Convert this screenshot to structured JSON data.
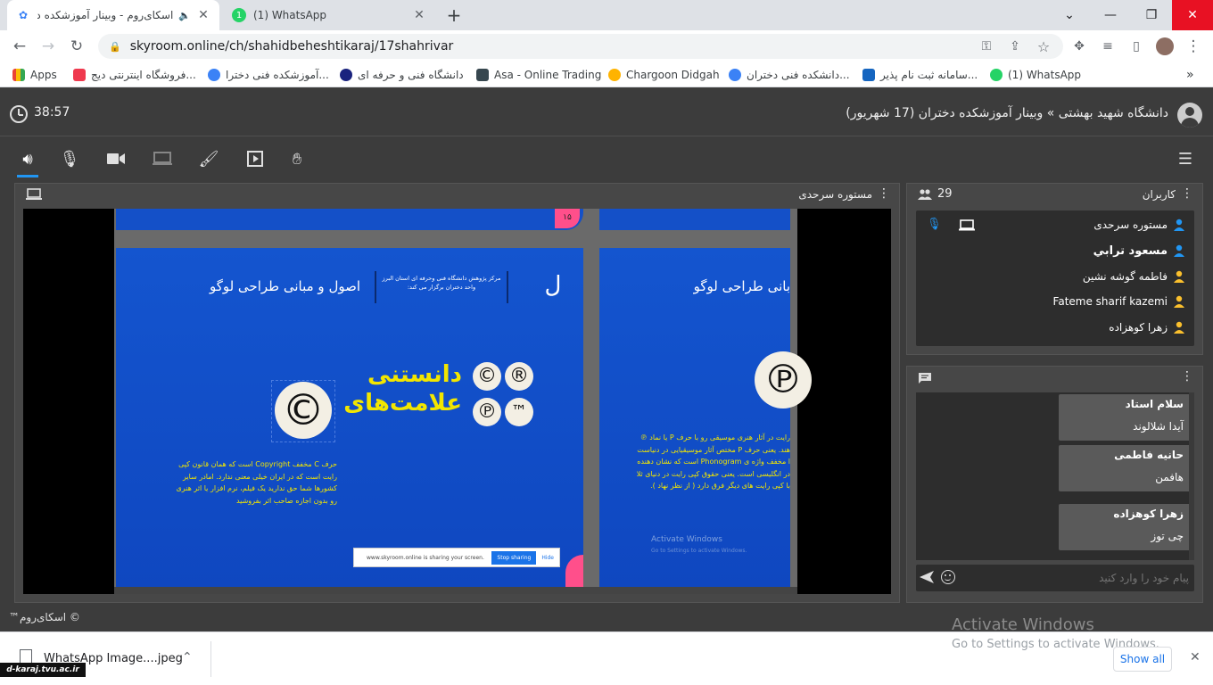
{
  "browser": {
    "tabs": [
      {
        "title": "اسکای‌روم - وبینار آموزشکده دخ",
        "active": true
      },
      {
        "title": "(1) WhatsApp",
        "active": false
      }
    ],
    "new_tab": "+",
    "url": "skyroom.online/ch/shahidbeheshtikaraj/17shahrivar",
    "bookmarks": [
      "Apps",
      "فروشگاه اینترنتی دیج...",
      "آموزشکده فنی دخترا...",
      "دانشگاه فنی و حرفه ای",
      "Asa - Online Trading",
      "Chargoon Didgah",
      "دانشکده فنی دختران...",
      "سامانه ثبت نام پذیر...",
      "(1) WhatsApp"
    ],
    "more_bookmarks": "»"
  },
  "header": {
    "timer": "38:57",
    "title": "دانشگاه شهید بهشتی » وبینار آموزشکده دختران (17 شهریور)"
  },
  "screen_panel": {
    "presenter": "مستوره سرحدی"
  },
  "slide": {
    "page_number": "۱۵",
    "header_org": "مرکز پژوهش دانشگاه فنی وحرفه ای استان البرز واحد دختران برگزار می کند:",
    "title": "اصول و مبانی طراحی لوگو",
    "title_right": "بانی طراحی لوگو",
    "heading_line1": "دانستنی",
    "heading_line2": "علامت‌های",
    "symbols": [
      "©",
      "®",
      "℗",
      "™"
    ],
    "body": "حرف C مخفف Copyright است که همان قانون کپی رایت است که در ایران خیلی معنی ندارد. امادر سایر کشورها شما حق ندارید یک فیلم، نرم افزار یا اثر هنری رو بدون اجازه صاحب اثر بفروشید",
    "body_right": "رایت در آثار هنری موسیقی رو با حرف P یا نماد ℗ هند. یعنی حرف P مختص آثار موسیقیایی در دنیاست ا مخفف واژه ی Phonogram است که نشان دهنده در انگلیسی است. یعنی حقوق کپی رایت در دنیای ثلا با کپی رایت های دیگر فرق دارد ( از نظر نهاد ).",
    "sharing_bar_text": "www.skyroom.online is sharing your screen.",
    "stop_sharing": "Stop sharing",
    "hide": "Hide",
    "watermark": "Activate Windows",
    "watermark_sub": "Go to Settings to activate Windows."
  },
  "users_panel": {
    "title": "کاربران",
    "count": "29",
    "users": [
      {
        "name": "مستوره سرحدی",
        "color": "#2196f3",
        "bold": false
      },
      {
        "name": "مسعود ترابي",
        "color": "#2196f3",
        "bold": true
      },
      {
        "name": "فاطمه گوشه نشین",
        "color": "#fbc02d",
        "bold": false
      },
      {
        "name": "Fateme sharif kazemi",
        "color": "#fbc02d",
        "bold": false
      },
      {
        "name": "زهرا کوهزاده",
        "color": "#fbc02d",
        "bold": false
      }
    ]
  },
  "chat": {
    "messages": [
      {
        "sender": "سلام استاد",
        "text": "آیدا شلالوند"
      },
      {
        "sender": "حانیه فاطمی",
        "text": "هافمن"
      },
      {
        "sender": "زهرا کوهزاده",
        "text": "چی توز"
      }
    ],
    "input_placeholder": "پیام خود را وارد کنید"
  },
  "footer": {
    "brand": "© اسکای‌روم™"
  },
  "download_bar": {
    "file": "WhatsApp Image....jpeg",
    "show_all": "Show all"
  },
  "os_watermark": {
    "title": "Activate Windows",
    "subtitle": "Go to Settings to activate Windows."
  },
  "logo_text": "d-karaj.tvu.ac.ir"
}
